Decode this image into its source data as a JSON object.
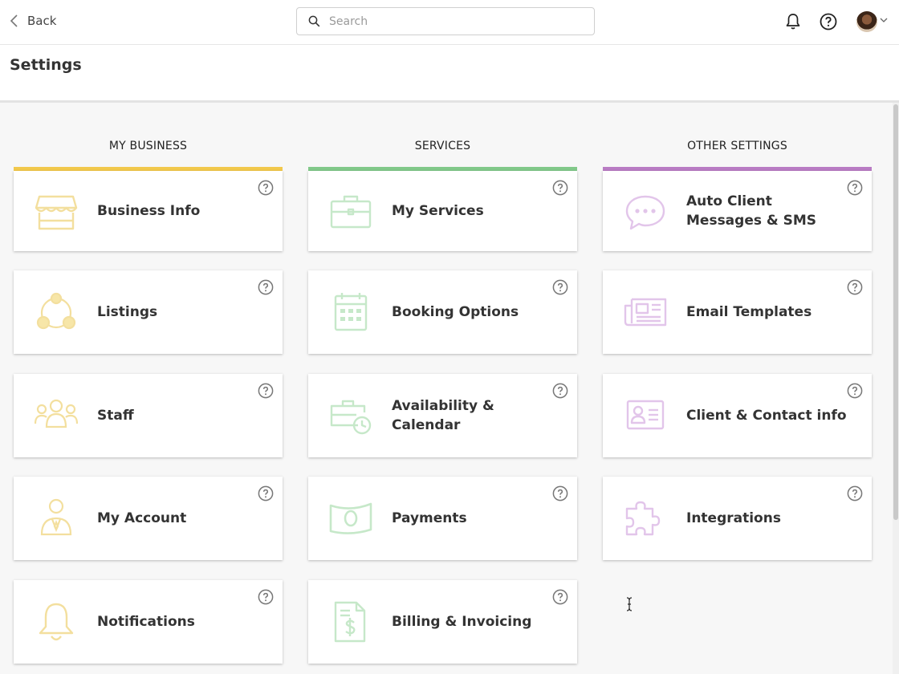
{
  "header": {
    "back_label": "Back",
    "search_placeholder": "Search"
  },
  "page_title": "Settings",
  "colors": {
    "my_business": "#f2c94c",
    "services": "#82c98a",
    "other_settings": "#b97cc4"
  },
  "columns": [
    {
      "heading": "MY BUSINESS",
      "cards": [
        {
          "label": "Business Info",
          "icon": "storefront-icon"
        },
        {
          "label": "Listings",
          "icon": "listings-network-icon"
        },
        {
          "label": "Staff",
          "icon": "staff-group-icon"
        },
        {
          "label": "My Account",
          "icon": "user-account-icon"
        },
        {
          "label": "Notifications",
          "icon": "bell-icon"
        }
      ]
    },
    {
      "heading": "SERVICES",
      "cards": [
        {
          "label": "My Services",
          "icon": "briefcase-icon"
        },
        {
          "label": "Booking Options",
          "icon": "calendar-grid-icon"
        },
        {
          "label": "Availability & Calendar",
          "icon": "briefcase-clock-icon"
        },
        {
          "label": "Payments",
          "icon": "banknote-icon"
        },
        {
          "label": "Billing & Invoicing",
          "icon": "invoice-dollar-icon"
        }
      ]
    },
    {
      "heading": "OTHER SETTINGS",
      "cards": [
        {
          "label": "Auto Client Messages & SMS",
          "icon": "chat-bubble-icon"
        },
        {
          "label": "Email Templates",
          "icon": "newspaper-icon"
        },
        {
          "label": "Client & Contact info",
          "icon": "contact-card-icon"
        },
        {
          "label": "Integrations",
          "icon": "puzzle-icon"
        }
      ]
    }
  ]
}
